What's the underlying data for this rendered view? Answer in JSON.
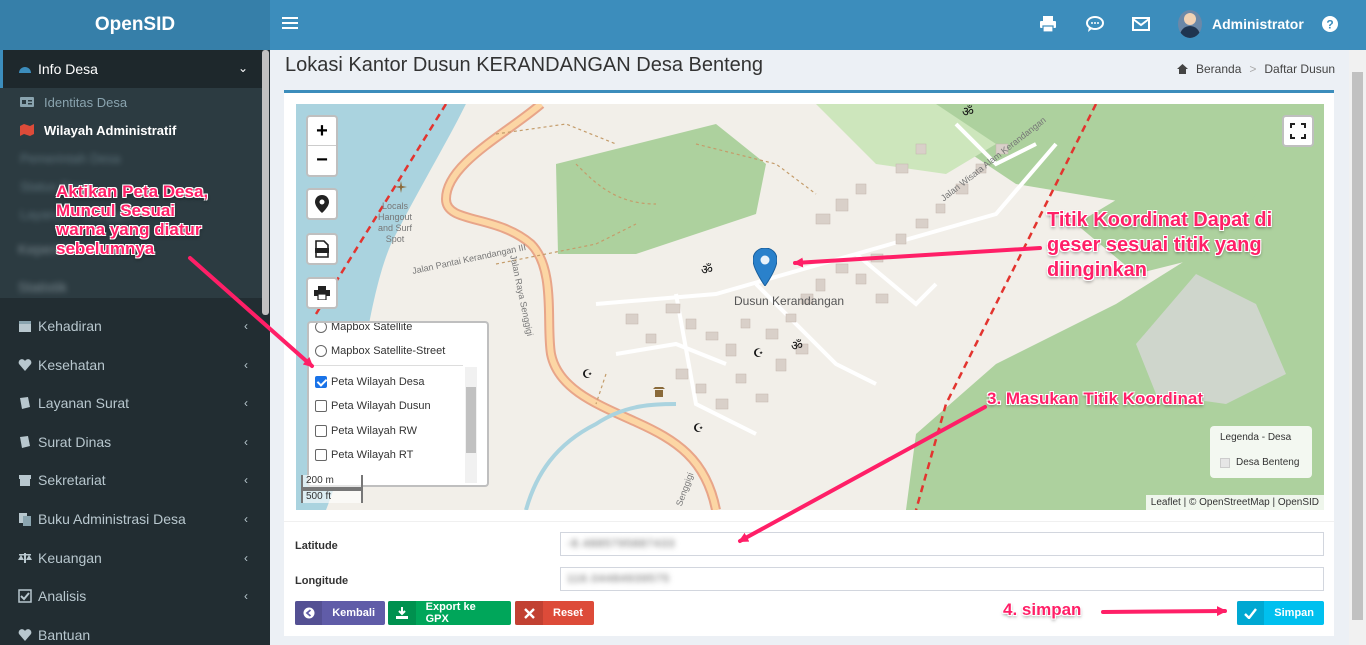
{
  "app": {
    "title": "OpenSID"
  },
  "topbar": {
    "user_name": "Administrator"
  },
  "sidebar": {
    "active_group": "Info Desa",
    "sub_items": [
      {
        "label": "Identitas Desa"
      },
      {
        "label": "Wilayah Administratif"
      },
      {
        "label": "Pemerintah Desa"
      },
      {
        "label": "Status Desa"
      },
      {
        "label": "Layanan Pelanggan"
      }
    ],
    "menu": [
      {
        "label": "Kependudukan"
      },
      {
        "label": "Statistik"
      },
      {
        "label": "Kehadiran"
      },
      {
        "label": "Kesehatan"
      },
      {
        "label": "Layanan Surat"
      },
      {
        "label": "Surat Dinas"
      },
      {
        "label": "Sekretariat"
      },
      {
        "label": "Buku Administrasi Desa"
      },
      {
        "label": "Keuangan"
      },
      {
        "label": "Analisis"
      },
      {
        "label": "Bantuan"
      }
    ]
  },
  "page": {
    "title": "Lokasi Kantor Dusun KERANDANGAN Desa Benteng",
    "breadcrumb": {
      "home": "Beranda",
      "current": "Daftar Dusun"
    }
  },
  "map": {
    "zoom_in": "+",
    "zoom_out": "−",
    "layers": {
      "partial": "Mapbox Satellite",
      "base": "Mapbox Satellite-Street",
      "overlays": [
        {
          "label": "Peta Wilayah Desa",
          "checked": true
        },
        {
          "label": "Peta Wilayah Dusun",
          "checked": false
        },
        {
          "label": "Peta Wilayah RW",
          "checked": false
        },
        {
          "label": "Peta Wilayah RT",
          "checked": false
        }
      ]
    },
    "scale": {
      "metric": "200 m",
      "imperial": "500 ft"
    },
    "legend": {
      "title": "Legenda - Desa",
      "item": "Desa Benteng"
    },
    "attribution": "Leaflet | © OpenStreetMap | OpenSID",
    "marker_label": "Dusun Kerandangan",
    "place_labels": {
      "locals": "Locals\nHangout\nand Surf\nSpot",
      "road1": "Jalan Pantai Kerandangan III",
      "road2": "Jalan Raya Senggigi",
      "road3": "Jalan Wisata Alam Kerandangan",
      "road4": "Senggigi"
    }
  },
  "form": {
    "latitude_label": "Latitude",
    "latitude_value": "-8.4885795887433",
    "longitude_label": "Longitude",
    "longitude_value": "116.04484939575"
  },
  "buttons": {
    "back": "Kembali",
    "export": "Export ke GPX",
    "reset": "Reset",
    "save": "Simpan"
  },
  "annotations": {
    "a1": "Aktikan Peta Desa,\nMuncul Sesuai\nwarna yang diatur\nsebelumnya",
    "a2": "Titik Koordinat Dapat di\ngeser sesuai titik yang\ndiinginkan",
    "a3": "3. Masukan Titik Koordinat",
    "a4": "4. simpan"
  },
  "colors": {
    "topbar": "#3c8dbc",
    "sidebar": "#222d32",
    "annotation": "#ff1f67",
    "btn_back": "#605ca8",
    "btn_export": "#00a65a",
    "btn_reset": "#dd4b39",
    "btn_save": "#00c0ef"
  }
}
